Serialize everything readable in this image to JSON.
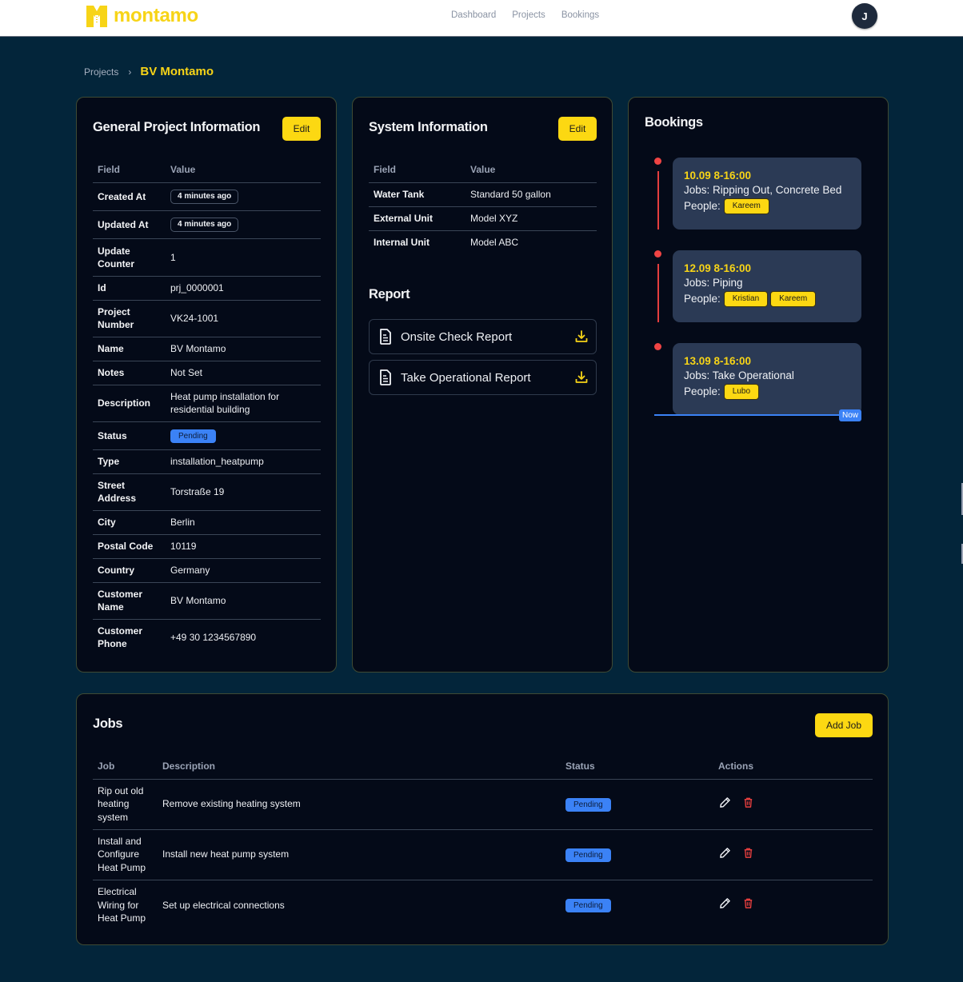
{
  "header": {
    "brand": "montamo",
    "nav": [
      "Dashboard",
      "Projects",
      "Bookings"
    ],
    "avatar_initial": "J"
  },
  "breadcrumb": {
    "parent": "Projects",
    "separator": "›",
    "current": "BV Montamo"
  },
  "general": {
    "title": "General Project Information",
    "edit_label": "Edit",
    "columns": [
      "Field",
      "Value"
    ],
    "rows": [
      {
        "field": "Created At",
        "value": "4 minutes ago"
      },
      {
        "field": "Updated At",
        "value": "4 minutes ago"
      },
      {
        "field": "Update Counter",
        "value": "1"
      },
      {
        "field": "Id",
        "value": "prj_0000001"
      },
      {
        "field": "Project Number",
        "value": "VK24-1001"
      },
      {
        "field": "Name",
        "value": "BV Montamo"
      },
      {
        "field": "Notes",
        "value": "Not Set"
      },
      {
        "field": "Description",
        "value": "Heat pump installation for residential building"
      },
      {
        "field": "Status",
        "value": "Pending"
      },
      {
        "field": "Type",
        "value": "installation_heatpump"
      },
      {
        "field": "Street Address",
        "value": "Torstraße 19"
      },
      {
        "field": "City",
        "value": "Berlin"
      },
      {
        "field": "Postal Code",
        "value": "10119"
      },
      {
        "field": "Country",
        "value": "Germany"
      },
      {
        "field": "Customer Name",
        "value": "BV Montamo"
      },
      {
        "field": "Customer Phone",
        "value": "+49 30 1234567890"
      }
    ]
  },
  "system": {
    "title": "System Information",
    "edit_label": "Edit",
    "columns": [
      "Field",
      "Value"
    ],
    "rows": [
      {
        "field": "Water Tank",
        "value": "Standard 50 gallon"
      },
      {
        "field": "External Unit",
        "value": "Model XYZ"
      },
      {
        "field": "Internal Unit",
        "value": "Model ABC"
      }
    ],
    "report_title": "Report",
    "reports": [
      {
        "label": "Onsite Check Report",
        "icon": "document-icon",
        "action_icon": "download-icon"
      },
      {
        "label": "Take Operational Report",
        "icon": "document-icon",
        "action_icon": "download-icon"
      }
    ]
  },
  "bookings": {
    "title": "Bookings",
    "items": [
      {
        "date": "10.09 8-16:00",
        "jobs": "Jobs: Ripping Out, Concrete Bed",
        "people_label": "People:",
        "people": [
          "Kareem"
        ]
      },
      {
        "date": "12.09 8-16:00",
        "jobs": "Jobs: Piping",
        "people_label": "People:",
        "people": [
          "Kristian",
          "Kareem"
        ]
      },
      {
        "date": "13.09 8-16:00",
        "jobs": "Jobs: Take Operational",
        "people_label": "People:",
        "people": [
          "Lubo"
        ]
      }
    ],
    "now_label": "Now"
  },
  "jobs": {
    "title": "Jobs",
    "add_label": "Add Job",
    "columns": [
      "Job",
      "Description",
      "Status",
      "Actions"
    ],
    "rows": [
      {
        "job": "Rip out old heating system",
        "description": "Remove existing heating system",
        "status": "Pending"
      },
      {
        "job": "Install and Configure Heat Pump",
        "description": "Install new heat pump system",
        "status": "Pending"
      },
      {
        "job": "Electrical Wiring for Heat Pump",
        "description": "Set up electrical connections",
        "status": "Pending"
      }
    ]
  },
  "colors": {
    "brand_yellow": "#f7d417",
    "page_bg": "#03253a",
    "card_bg": "#040a18",
    "status_blue": "#3b82f6",
    "timeline_red": "#ef4444",
    "booking_bg": "#2b3a55"
  }
}
